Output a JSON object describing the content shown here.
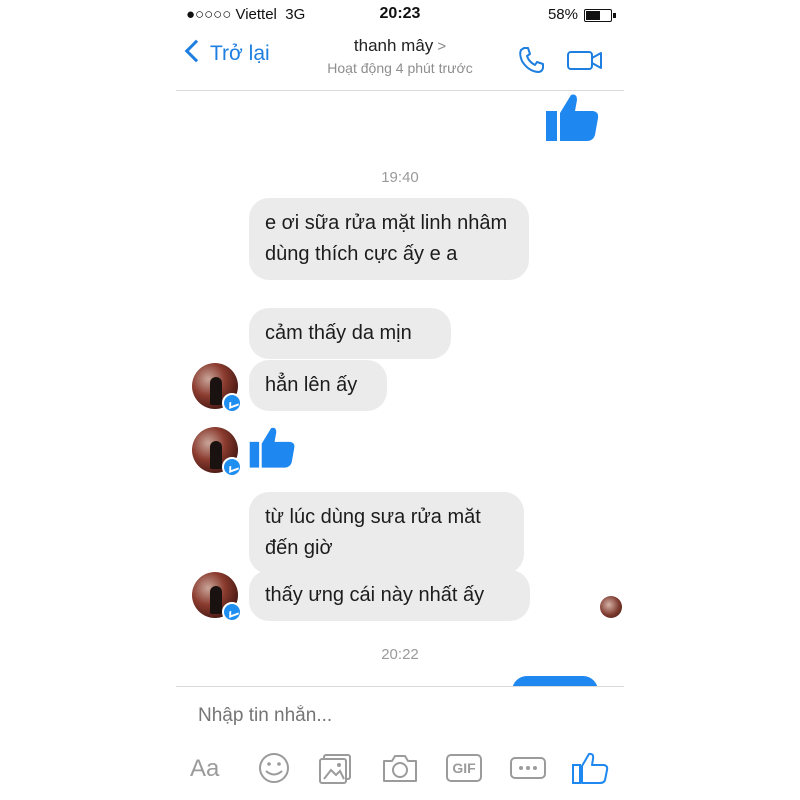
{
  "status_bar": {
    "carrier": "●○○○○ Viettel",
    "network": "3G",
    "time": "20:23",
    "battery": "58%"
  },
  "header": {
    "back_label": "Trở lại",
    "contact_name": "thanh mây",
    "contact_arrow": ">",
    "status": "Hoạt động 4 phút trước"
  },
  "chat": {
    "timestamp_1": "19:40",
    "messages": [
      "e ơi sữa rửa mặt linh nhâm dùng thích cực ấy e a",
      "cảm thấy da mịn",
      "hẳn lên ấy",
      "từ lúc dùng sưa rửa măt đến giờ",
      "thấy ưng cái này nhất ấy"
    ],
    "timestamp_2": "20:22"
  },
  "composer": {
    "placeholder": "Nhập tin nhắn...",
    "aa_label": "Aa",
    "gif_label": "GIF",
    "icons": [
      "aa-icon",
      "emoji-icon",
      "image-icon",
      "camera-icon",
      "gif-icon",
      "more-icon",
      "like-icon"
    ]
  },
  "colors": {
    "accent": "#1e7fe0",
    "like": "#1e88f0",
    "bubble": "#ebebeb"
  }
}
